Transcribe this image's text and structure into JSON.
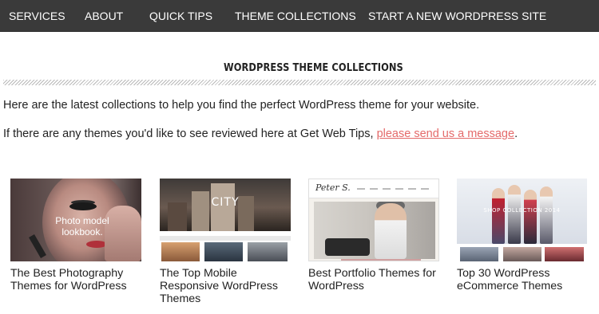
{
  "nav": {
    "items": [
      {
        "label": "SERVICES"
      },
      {
        "label": "ABOUT"
      },
      {
        "label": "QUICK TIPS"
      },
      {
        "label": "THEME COLLECTIONS"
      },
      {
        "label": "START A NEW WORDPRESS SITE"
      }
    ]
  },
  "section": {
    "title": "WORDPRESS THEME COLLECTIONS"
  },
  "intro": {
    "line1": "Here are the latest collections to help you find the perfect WordPress theme for your website.",
    "line2_prefix": "If there are any themes you'd like to see reviewed here at Get Web Tips, ",
    "line2_link": "please send us a message",
    "line2_suffix": "."
  },
  "cards": [
    {
      "title": "The Best Photography Themes for WordPress",
      "thumb_text": "Photo model lookbook."
    },
    {
      "title": "The Top Mobile Responsive WordPress Themes",
      "thumb_text": "CITY"
    },
    {
      "title": "Best Portfolio Themes for WordPress",
      "thumb_text": "Peter S."
    },
    {
      "title": "Top 30 WordPress eCommerce Themes",
      "thumb_text": "SHOP COLLECTION 2014"
    }
  ],
  "colors": {
    "nav_bg": "#3a3a3a",
    "link": "#e46a6a"
  }
}
